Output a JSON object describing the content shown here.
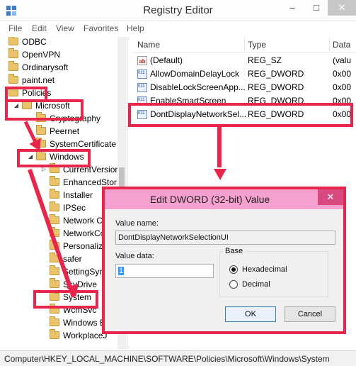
{
  "window": {
    "title": "Registry Editor",
    "minimize_glyph": "–",
    "maximize_glyph": "□",
    "close_glyph": "✕"
  },
  "menu": [
    "File",
    "Edit",
    "View",
    "Favorites",
    "Help"
  ],
  "tree": {
    "items": [
      {
        "label": "ODBC",
        "expander": ""
      },
      {
        "label": "OpenVPN",
        "expander": ""
      },
      {
        "label": "Ordinarysoft",
        "expander": ""
      },
      {
        "label": "paint.net",
        "expander": ""
      },
      {
        "label": "Policies",
        "expander": ""
      },
      {
        "label": "Microsoft",
        "expander": "◢"
      },
      {
        "label": "Cryptography",
        "expander": ""
      },
      {
        "label": "Peernet",
        "expander": ""
      },
      {
        "label": "SystemCertificate",
        "expander": ""
      },
      {
        "label": "Windows",
        "expander": "◢"
      },
      {
        "label": "CurrentVersion",
        "expander": "▷"
      },
      {
        "label": "EnhancedStor",
        "expander": ""
      },
      {
        "label": "Installer",
        "expander": ""
      },
      {
        "label": "IPSec",
        "expander": ""
      },
      {
        "label": "Network C",
        "expander": ""
      },
      {
        "label": "NetworkCo",
        "expander": ""
      },
      {
        "label": "Personaliza",
        "expander": ""
      },
      {
        "label": "safer",
        "expander": ""
      },
      {
        "label": "SettingSyn",
        "expander": ""
      },
      {
        "label": "SkyDrive",
        "expander": ""
      },
      {
        "label": "System",
        "expander": ""
      },
      {
        "label": "WcmSvc",
        "expander": ""
      },
      {
        "label": "Windows E",
        "expander": ""
      },
      {
        "label": "WorkplaceJ",
        "expander": ""
      }
    ]
  },
  "list": {
    "columns": [
      "Name",
      "Type",
      "Data"
    ],
    "rows": [
      {
        "icon": "string-value-icon",
        "name": "(Default)",
        "type": "REG_SZ",
        "data": "(valu"
      },
      {
        "icon": "dword-value-icon",
        "name": "AllowDomainDelayLock",
        "type": "REG_DWORD",
        "data": "0x00"
      },
      {
        "icon": "dword-value-icon",
        "name": "DisableLockScreenApp...",
        "type": "REG_DWORD",
        "data": "0x00"
      },
      {
        "icon": "dword-value-icon",
        "name": "EnableSmartScreen",
        "type": "REG_DWORD",
        "data": "0x00"
      },
      {
        "icon": "dword-value-icon",
        "name": "DontDisplayNetworkSel...",
        "type": "REG_DWORD",
        "data": "0x00"
      }
    ]
  },
  "status_path": "Computer\\HKEY_LOCAL_MACHINE\\SOFTWARE\\Policies\\Microsoft\\Windows\\System",
  "dialog": {
    "title": "Edit DWORD (32-bit) Value",
    "close_glyph": "✕",
    "value_name_label": "Value name:",
    "value_name": "DontDisplayNetworkSelectionUI",
    "value_data_label": "Value data:",
    "value_data": "1",
    "base_label": "Base",
    "hex_label": "Hexadecimal",
    "dec_label": "Decimal",
    "base_selected": "Hexadecimal",
    "ok_label": "OK",
    "cancel_label": "Cancel"
  },
  "colors": {
    "highlight": "#e8264b",
    "dialog_title": "#f5a0cf",
    "folder": "#e9c26a"
  },
  "icons": {
    "app": "registry-editor-icon",
    "folder": "folder-icon"
  }
}
